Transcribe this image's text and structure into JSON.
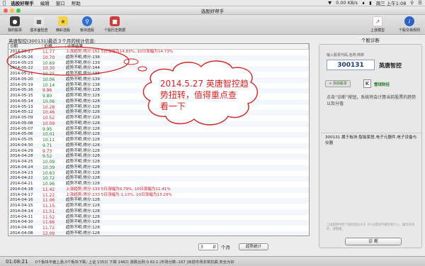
{
  "menubar": {
    "app_name": "选股好帮手",
    "items": [
      "编辑",
      "窗口",
      "帮助"
    ],
    "net_speed": "0.00 KB/s",
    "clock": "周三 上午1:08"
  },
  "window": {
    "title": "选股好帮手"
  },
  "toolbar": {
    "buttons": [
      {
        "label": "我的股票"
      },
      {
        "label": "基本面检查"
      },
      {
        "label": "精彩选股"
      },
      {
        "label": "板块选股"
      },
      {
        "label": "个股历史数据"
      }
    ],
    "right_buttons": [
      {
        "label": "上涨模型"
      },
      {
        "label": "个股交易规则"
      }
    ]
  },
  "left": {
    "info_line": "英唐智控(300131)最近３个月的统计信息:",
    "columns": [
      "日期",
      "价格",
      "计算结果"
    ],
    "rows": [
      {
        "date": "2014-05-27",
        "price": "11.77",
        "result": "上涨趋势,得分:151 5日涨幅为14.83%, 10日涨幅为14.73%",
        "color": "red"
      },
      {
        "date": "2014-05-26",
        "price": "10.70",
        "result": "趋势不明,得分:138",
        "color": "red"
      },
      {
        "date": "2014-05-23",
        "price": "10.69",
        "result": "趋势不明,得分:139",
        "color": "green"
      },
      {
        "date": "2014-05-22",
        "price": "10.30",
        "result": "趋势不明,得分:144",
        "color": "red"
      },
      {
        "date": "2014-05-21",
        "price": "10.25",
        "result": "趋势不明,得分:138",
        "color": "green"
      },
      {
        "date": "2014-05-20",
        "price": "10.06",
        "result": "趋势不明,得分:139",
        "color": "green"
      },
      {
        "date": "2014-05-19",
        "price": "10.14",
        "result": "趋势不明,得分:138",
        "color": "green"
      },
      {
        "date": "2014-05-16",
        "price": "9.96",
        "result": "趋势不明,得分:128",
        "color": "red"
      },
      {
        "date": "2014-05-15",
        "price": "9.80",
        "result": "趋势不明,得分:128",
        "color": "green"
      },
      {
        "date": "2014-05-14",
        "price": "10.06",
        "result": "趋势不明,得分:128",
        "color": "green"
      },
      {
        "date": "2014-05-13",
        "price": "10.28",
        "result": "趋势不明,得分:128",
        "color": "red"
      },
      {
        "date": "2014-05-12",
        "price": "10.46",
        "result": "趋势不明,得分:128",
        "color": "red"
      },
      {
        "date": "2014-05-09",
        "price": "10.52",
        "result": "趋势不明,得分:128",
        "color": "red"
      },
      {
        "date": "2014-05-08",
        "price": "10.09",
        "result": "趋势不明,得分:128",
        "color": "red"
      },
      {
        "date": "2014-05-07",
        "price": "9.95",
        "result": "趋势不明,得分:128",
        "color": "green"
      },
      {
        "date": "2014-05-06",
        "price": "10.01",
        "result": "趋势不明,得分:128",
        "color": "green"
      },
      {
        "date": "2014-05-05",
        "price": "10.11",
        "result": "趋势不明,得分:128",
        "color": "green"
      },
      {
        "date": "2014-04-30",
        "price": "9.71",
        "result": "趋势不明,得分:128",
        "color": "green"
      },
      {
        "date": "2014-04-29",
        "price": "9.73",
        "result": "趋势不明,得分:128",
        "color": "red"
      },
      {
        "date": "2014-04-28",
        "price": "9.52",
        "result": "趋势不明,得分:128",
        "color": "green"
      },
      {
        "date": "2014-04-25",
        "price": "10.09",
        "result": "趋势不明,得分:128",
        "color": "green"
      },
      {
        "date": "2014-04-24",
        "price": "10.39",
        "result": "趋势不明,得分:128",
        "color": "green"
      },
      {
        "date": "2014-04-23",
        "price": "10.63",
        "result": "趋势不明,得分:128",
        "color": "green"
      },
      {
        "date": "2014-04-22",
        "price": "10.72",
        "result": "趋势不明,得分:128",
        "color": "green"
      },
      {
        "date": "2014-04-21",
        "price": "10.96",
        "result": "趋势不明,得分:128",
        "color": "green"
      },
      {
        "date": "2014-04-18",
        "price": "11.42",
        "result": "上涨趋势,得分:133 5日涨幅为0.79%, 10日涨幅为11.41%",
        "color": "red"
      },
      {
        "date": "2014-04-17",
        "price": "11.22",
        "result": "上涨趋势,得分:133 5日涨幅为-1.13%, 10日涨幅为13.29%",
        "color": "red"
      },
      {
        "date": "2014-04-16",
        "price": "11.06",
        "result": "趋势不明,得分:128",
        "color": "red"
      },
      {
        "date": "2014-04-15",
        "price": "11.15",
        "result": "趋势不明,得分:128",
        "color": "red"
      },
      {
        "date": "2014-04-14",
        "price": "11.51",
        "result": "趋势不明,得分:128",
        "color": "red"
      },
      {
        "date": "2014-04-11",
        "price": "11.52",
        "result": "趋势不明,得分:128",
        "color": "red"
      },
      {
        "date": "2014-04-10",
        "price": "11.66",
        "result": "趋势不明,得分:128",
        "color": "red"
      },
      {
        "date": "2014-04-09",
        "price": "11.72",
        "result": "趋势不明,得分:128",
        "color": "red"
      },
      {
        "date": "2014-04-08",
        "price": "12.09",
        "result": "趋势不明,得分:128",
        "color": "red"
      }
    ],
    "period_value": "3",
    "period_unit": "个月",
    "stats_button": "趋势统计"
  },
  "right": {
    "title": "个股诊断",
    "hint": "输入股票代码,名称,简拼",
    "code": "300131",
    "name": "英唐智控",
    "add_button": "添加股票",
    "k_icon": "K",
    "snowball_link": "雪球财经",
    "description": "点击“诊断”按钮，系统将会计算当前股票的趋势以及分值",
    "sector": "300131 属于板块:智能家居,电子元器件,电子设备与仪器",
    "note": "上涨趋势中若个股的得分大于 70 分建议不要轻易介入，操作有风险，请慎重。",
    "diagnose_button": "诊  断"
  },
  "status": {
    "time": "01:08:21",
    "ticker": "0个板块平盘上涨,0个板块下跌; 上证 135只 下跌 146只 涨跌比例 0.92:1 |市场分数:-167 |目前市场非常抗跌,安全为好"
  },
  "annotation": {
    "bubble_text_line1": "2014.5.27 英唐智控趋",
    "bubble_text_line2": "势扭转，值得重点查",
    "bubble_text_line3": "看一下"
  },
  "colors": {
    "red": "#d4232b",
    "green": "#1b7a21",
    "annotation": "#d62222"
  }
}
